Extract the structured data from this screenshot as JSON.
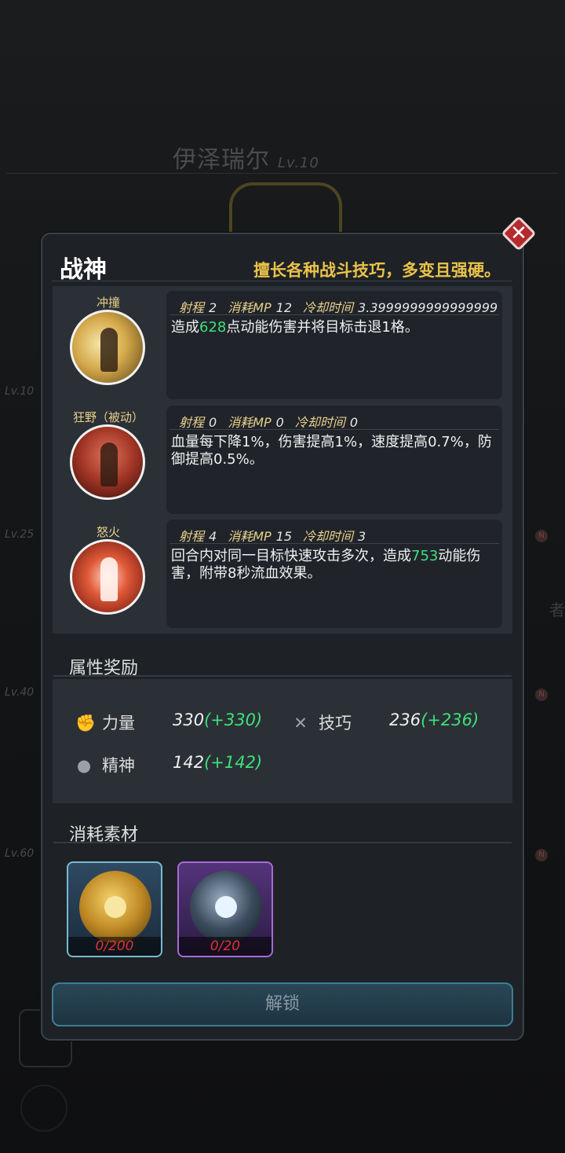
{
  "background": {
    "hero_name": "伊泽瑞尔",
    "hero_level": "Lv.10",
    "tier_levels": [
      "Lv.10",
      "Lv.25",
      "Lv.40",
      "Lv.60"
    ],
    "side_text": "者",
    "badge": "N"
  },
  "dialog": {
    "title": "战神",
    "description": "擅长各种战斗技巧，多变且强硬。",
    "close_symbol": "✕",
    "skills": [
      {
        "name": "冲撞",
        "range_label": "射程",
        "range": "2",
        "mp_label": "消耗MP",
        "mp": "12",
        "cooldown_label": "冷却时间",
        "cooldown": "3.3999999999999999",
        "text_before": "造成",
        "value": "628",
        "text_after": "点动能伤害并将目标击退1格。"
      },
      {
        "name": "狂野（被动）",
        "range_label": "射程",
        "range": "0",
        "mp_label": "消耗MP",
        "mp": "0",
        "cooldown_label": "冷却时间",
        "cooldown": "0",
        "text_before": "血量每下降1%，伤害提高1%，速度提高0.7%，防御提高0.5%。",
        "value": "",
        "text_after": ""
      },
      {
        "name": "怒火",
        "range_label": "射程",
        "range": "4",
        "mp_label": "消耗MP",
        "mp": "15",
        "cooldown_label": "冷却时间",
        "cooldown": "3",
        "text_before": "回合内对同一目标快速攻击多次，造成",
        "value": "753",
        "text_after": "动能伤害，附带8秒流血效果。"
      }
    ],
    "attributes_title": "属性奖励",
    "attributes": [
      {
        "icon": "fist-icon",
        "label": "力量",
        "value": "330",
        "bonus": "(+330)"
      },
      {
        "icon": "tools-icon",
        "label": "技巧",
        "value": "236",
        "bonus": "(+236)"
      },
      {
        "icon": "brain-icon",
        "label": "精神",
        "value": "142",
        "bonus": "(+142)"
      }
    ],
    "materials_title": "消耗素材",
    "materials": [
      {
        "name": "gold-core-orb",
        "count": "0/200"
      },
      {
        "name": "blue-core-orb",
        "count": "0/20"
      }
    ],
    "unlock_label": "解锁"
  },
  "colors": {
    "accent_gold": "#e9c24a",
    "bonus_green": "#3de07a",
    "count_red": "#e03232",
    "close_red": "#b52a2e"
  }
}
